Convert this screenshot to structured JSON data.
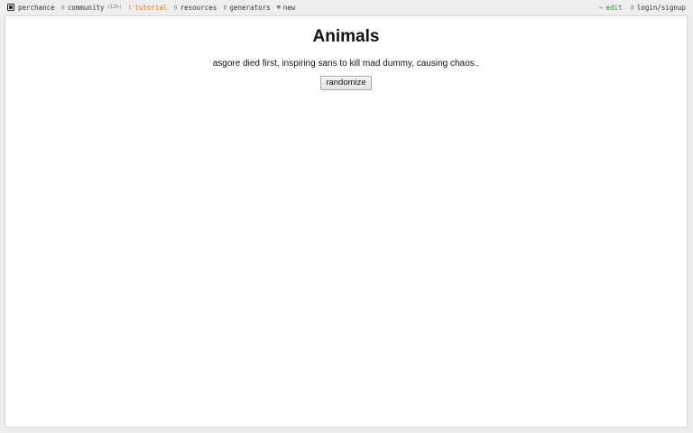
{
  "topbar": {
    "left": [
      {
        "label": "perchance"
      },
      {
        "icon": "▯",
        "label": "community",
        "count": "(12h)"
      },
      {
        "icon": "▯",
        "label": "tutorial"
      },
      {
        "icon": "▯",
        "label": "resources"
      },
      {
        "icon": "▯",
        "label": "generators"
      },
      {
        "icon": "⊕",
        "label": "new"
      }
    ],
    "right": [
      {
        "icon": "✏",
        "label": "edit"
      },
      {
        "icon": "▯",
        "label": "login/signup"
      }
    ],
    "colors": {
      "tutorial": "#e07b00",
      "edit": "#2c8a2c"
    }
  },
  "main": {
    "title": "Animals",
    "output": "asgore died first, inspiring sans to kill mad dummy, causing chaos..",
    "randomize_label": "randomize"
  }
}
